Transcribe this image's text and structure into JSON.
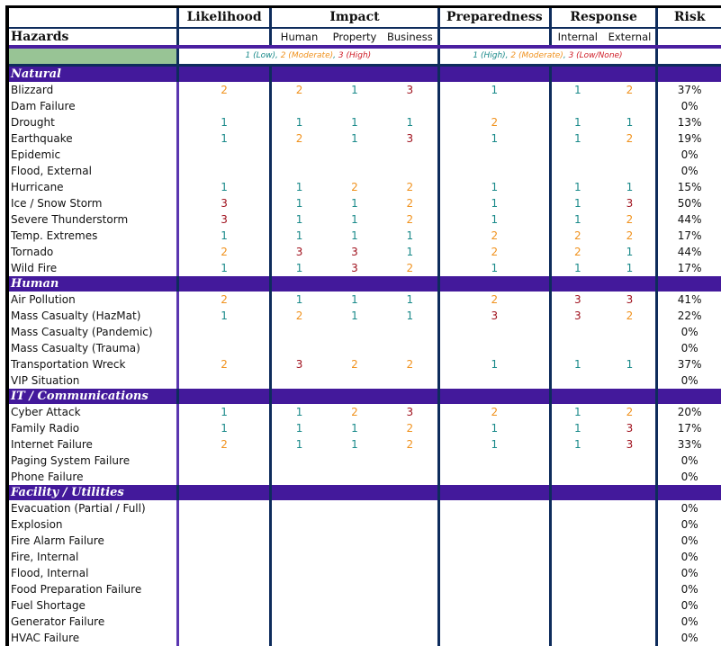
{
  "headers": {
    "likelihood": "Likelihood",
    "impact": "Impact",
    "preparedness": "Preparedness",
    "response": "Response",
    "risk": "Risk",
    "hazards": "Hazards",
    "impact_sub": [
      "Human",
      "Property",
      "Business"
    ],
    "response_sub": [
      "Internal",
      "External"
    ]
  },
  "legend": {
    "scale_a": [
      {
        "text": "1 (Low)",
        "level": 1
      },
      {
        "text": ", ",
        "level": 0
      },
      {
        "text": "2 (Moderate)",
        "level": 2
      },
      {
        "text": ", ",
        "level": 0
      },
      {
        "text": "3 (High)",
        "level": 3
      }
    ],
    "scale_b": [
      {
        "text": "1 (High)",
        "level": 1
      },
      {
        "text": ", ",
        "level": 0
      },
      {
        "text": "2 (Moderate)",
        "level": 2
      },
      {
        "text": ", ",
        "level": 0
      },
      {
        "text": "3 (Low/None)",
        "level": 3
      }
    ]
  },
  "colors": {
    "level_1": "#1a8a8a",
    "level_2": "#f0921e",
    "level_3": "#a0121e",
    "category_band": "#43199b",
    "legend_green": "#98c495"
  },
  "categories": [
    {
      "name": "Natural",
      "rows": [
        {
          "hazard": "Blizzard",
          "likelihood": "2",
          "human": "2",
          "property": "1",
          "business": "3",
          "preparedness": "1",
          "internal": "1",
          "external": "2",
          "risk": "37%"
        },
        {
          "hazard": "Dam Failure",
          "likelihood": "",
          "human": "",
          "property": "",
          "business": "",
          "preparedness": "",
          "internal": "",
          "external": "",
          "risk": "0%"
        },
        {
          "hazard": "Drought",
          "likelihood": "1",
          "human": "1",
          "property": "1",
          "business": "1",
          "preparedness": "2",
          "internal": "1",
          "external": "1",
          "risk": "13%"
        },
        {
          "hazard": "Earthquake",
          "likelihood": "1",
          "human": "2",
          "property": "1",
          "business": "3",
          "preparedness": "1",
          "internal": "1",
          "external": "2",
          "risk": "19%"
        },
        {
          "hazard": "Epidemic",
          "likelihood": "",
          "human": "",
          "property": "",
          "business": "",
          "preparedness": "",
          "internal": "",
          "external": "",
          "risk": "0%"
        },
        {
          "hazard": "Flood, External",
          "likelihood": "",
          "human": "",
          "property": "",
          "business": "",
          "preparedness": "",
          "internal": "",
          "external": "",
          "risk": "0%"
        },
        {
          "hazard": "Hurricane",
          "likelihood": "1",
          "human": "1",
          "property": "2",
          "business": "2",
          "preparedness": "1",
          "internal": "1",
          "external": "1",
          "risk": "15%"
        },
        {
          "hazard": "Ice / Snow Storm",
          "likelihood": "3",
          "human": "1",
          "property": "1",
          "business": "2",
          "preparedness": "1",
          "internal": "1",
          "external": "3",
          "risk": "50%"
        },
        {
          "hazard": "Severe Thunderstorm",
          "likelihood": "3",
          "human": "1",
          "property": "1",
          "business": "2",
          "preparedness": "1",
          "internal": "1",
          "external": "2",
          "risk": "44%"
        },
        {
          "hazard": "Temp. Extremes",
          "likelihood": "1",
          "human": "1",
          "property": "1",
          "business": "1",
          "preparedness": "2",
          "internal": "2",
          "external": "2",
          "risk": "17%"
        },
        {
          "hazard": "Tornado",
          "likelihood": "2",
          "human": "3",
          "property": "3",
          "business": "1",
          "preparedness": "2",
          "internal": "2",
          "external": "1",
          "risk": "44%"
        },
        {
          "hazard": "Wild Fire",
          "likelihood": "1",
          "human": "1",
          "property": "3",
          "business": "2",
          "preparedness": "1",
          "internal": "1",
          "external": "1",
          "risk": "17%"
        }
      ]
    },
    {
      "name": "Human",
      "rows": [
        {
          "hazard": "Air Pollution",
          "likelihood": "2",
          "human": "1",
          "property": "1",
          "business": "1",
          "preparedness": "2",
          "internal": "3",
          "external": "3",
          "risk": "41%"
        },
        {
          "hazard": "Mass Casualty (HazMat)",
          "likelihood": "1",
          "human": "2",
          "property": "1",
          "business": "1",
          "preparedness": "3",
          "internal": "3",
          "external": "2",
          "risk": "22%"
        },
        {
          "hazard": "Mass Casualty (Pandemic)",
          "likelihood": "",
          "human": "",
          "property": "",
          "business": "",
          "preparedness": "",
          "internal": "",
          "external": "",
          "risk": "0%"
        },
        {
          "hazard": "Mass Casualty (Trauma)",
          "likelihood": "",
          "human": "",
          "property": "",
          "business": "",
          "preparedness": "",
          "internal": "",
          "external": "",
          "risk": "0%"
        },
        {
          "hazard": "Transportation Wreck",
          "likelihood": "2",
          "human": "3",
          "property": "2",
          "business": "2",
          "preparedness": "1",
          "internal": "1",
          "external": "1",
          "risk": "37%"
        },
        {
          "hazard": "VIP Situation",
          "likelihood": "",
          "human": "",
          "property": "",
          "business": "",
          "preparedness": "",
          "internal": "",
          "external": "",
          "risk": "0%"
        }
      ]
    },
    {
      "name": "IT / Communications",
      "rows": [
        {
          "hazard": "Cyber Attack",
          "likelihood": "1",
          "human": "1",
          "property": "2",
          "business": "3",
          "preparedness": "2",
          "internal": "1",
          "external": "2",
          "risk": "20%"
        },
        {
          "hazard": "Family Radio",
          "likelihood": "1",
          "human": "1",
          "property": "1",
          "business": "2",
          "preparedness": "1",
          "internal": "1",
          "external": "3",
          "risk": "17%"
        },
        {
          "hazard": "Internet Failure",
          "likelihood": "2",
          "human": "1",
          "property": "1",
          "business": "2",
          "preparedness": "1",
          "internal": "1",
          "external": "3",
          "risk": "33%"
        },
        {
          "hazard": "Paging System Failure",
          "likelihood": "",
          "human": "",
          "property": "",
          "business": "",
          "preparedness": "",
          "internal": "",
          "external": "",
          "risk": "0%"
        },
        {
          "hazard": "Phone Failure",
          "likelihood": "",
          "human": "",
          "property": "",
          "business": "",
          "preparedness": "",
          "internal": "",
          "external": "",
          "risk": "0%"
        }
      ]
    },
    {
      "name": "Facility / Utilities",
      "rows": [
        {
          "hazard": "Evacuation (Partial / Full)",
          "likelihood": "",
          "human": "",
          "property": "",
          "business": "",
          "preparedness": "",
          "internal": "",
          "external": "",
          "risk": "0%"
        },
        {
          "hazard": "Explosion",
          "likelihood": "",
          "human": "",
          "property": "",
          "business": "",
          "preparedness": "",
          "internal": "",
          "external": "",
          "risk": "0%"
        },
        {
          "hazard": "Fire Alarm Failure",
          "likelihood": "",
          "human": "",
          "property": "",
          "business": "",
          "preparedness": "",
          "internal": "",
          "external": "",
          "risk": "0%"
        },
        {
          "hazard": "Fire, Internal",
          "likelihood": "",
          "human": "",
          "property": "",
          "business": "",
          "preparedness": "",
          "internal": "",
          "external": "",
          "risk": "0%"
        },
        {
          "hazard": "Flood, Internal",
          "likelihood": "",
          "human": "",
          "property": "",
          "business": "",
          "preparedness": "",
          "internal": "",
          "external": "",
          "risk": "0%"
        },
        {
          "hazard": "Food Preparation Failure",
          "likelihood": "",
          "human": "",
          "property": "",
          "business": "",
          "preparedness": "",
          "internal": "",
          "external": "",
          "risk": "0%"
        },
        {
          "hazard": "Fuel Shortage",
          "likelihood": "",
          "human": "",
          "property": "",
          "business": "",
          "preparedness": "",
          "internal": "",
          "external": "",
          "risk": "0%"
        },
        {
          "hazard": "Generator Failure",
          "likelihood": "",
          "human": "",
          "property": "",
          "business": "",
          "preparedness": "",
          "internal": "",
          "external": "",
          "risk": "0%"
        },
        {
          "hazard": "HVAC Failure",
          "likelihood": "",
          "human": "",
          "property": "",
          "business": "",
          "preparedness": "",
          "internal": "",
          "external": "",
          "risk": "0%"
        }
      ]
    }
  ]
}
